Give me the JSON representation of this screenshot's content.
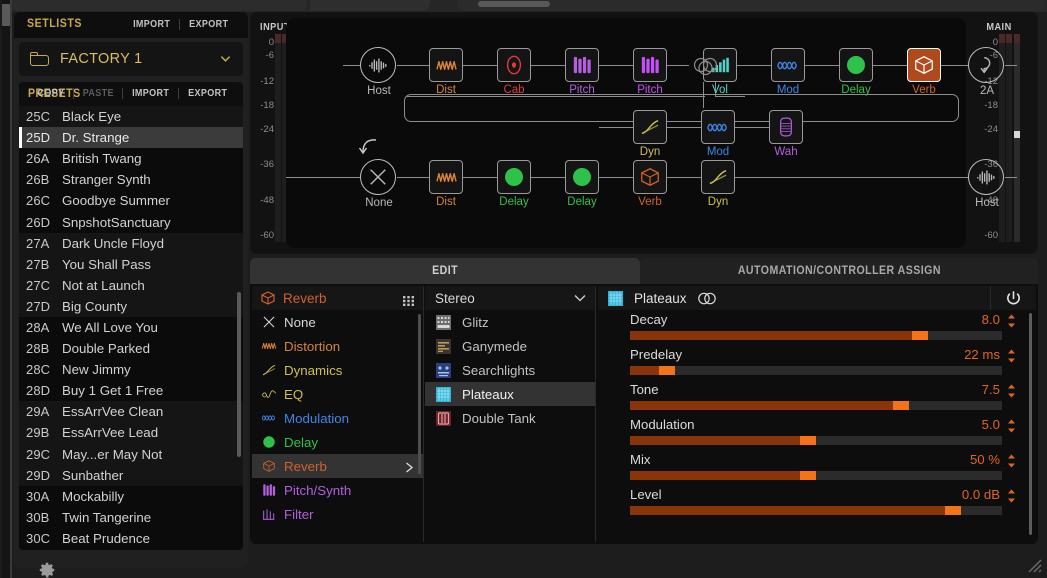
{
  "sidebar": {
    "setlists": {
      "title": "SETLISTS",
      "actions": [
        {
          "label": "IMPORT",
          "dim": false
        },
        {
          "label": "EXPORT",
          "dim": false
        }
      ],
      "selected": "FACTORY 1",
      "folder_icon": "folder-icon",
      "chevron_icon": "chevron-down-icon"
    },
    "presets": {
      "title": "PRESETS",
      "actions": [
        {
          "label": "COPY",
          "dim": false
        },
        {
          "label": "PASTE",
          "dim": true
        },
        {
          "label": "IMPORT",
          "dim": false
        },
        {
          "label": "EXPORT",
          "dim": false
        }
      ],
      "items": [
        {
          "num": "25C",
          "name": "Black Eye",
          "band": true,
          "selected": false
        },
        {
          "num": "25D",
          "name": "Dr. Strange",
          "band": true,
          "selected": true
        },
        {
          "num": "26A",
          "name": "British Twang",
          "band": false,
          "selected": false
        },
        {
          "num": "26B",
          "name": "Stranger Synth",
          "band": false,
          "selected": false
        },
        {
          "num": "26C",
          "name": "Goodbye Summer",
          "band": false,
          "selected": false
        },
        {
          "num": "26D",
          "name": "SnpshotSanctuary",
          "band": false,
          "selected": false
        },
        {
          "num": "27A",
          "name": "Dark Uncle Floyd",
          "band": true,
          "selected": false
        },
        {
          "num": "27B",
          "name": "You Shall Pass",
          "band": true,
          "selected": false
        },
        {
          "num": "27C",
          "name": "Not at Launch",
          "band": true,
          "selected": false
        },
        {
          "num": "27D",
          "name": "Big County",
          "band": true,
          "selected": false
        },
        {
          "num": "28A",
          "name": "We All Love You",
          "band": false,
          "selected": false
        },
        {
          "num": "28B",
          "name": "Double Parked",
          "band": false,
          "selected": false
        },
        {
          "num": "28C",
          "name": "New Jimmy",
          "band": false,
          "selected": false
        },
        {
          "num": "28D",
          "name": "Buy 1 Get 1 Free",
          "band": false,
          "selected": false
        },
        {
          "num": "29A",
          "name": "EssArrVee Clean",
          "band": true,
          "selected": false
        },
        {
          "num": "29B",
          "name": "EssArrVee Lead",
          "band": true,
          "selected": false
        },
        {
          "num": "29C",
          "name": "May...er May Not",
          "band": true,
          "selected": false
        },
        {
          "num": "29D",
          "name": "Sunbather",
          "band": true,
          "selected": false
        },
        {
          "num": "30A",
          "name": "Mockabilly",
          "band": false,
          "selected": false
        },
        {
          "num": "30B",
          "name": "Twin Tangerine",
          "band": false,
          "selected": false
        },
        {
          "num": "30C",
          "name": "Beat Prudence",
          "band": false,
          "selected": false
        }
      ]
    },
    "gear_icon": "gear-icon"
  },
  "routing": {
    "input_meter": {
      "label": "INPUT",
      "ticks": [
        "0",
        "-6",
        "-12",
        "-18",
        "-24",
        "-36",
        "-48",
        "-60"
      ],
      "peak_db": "-20"
    },
    "main_meter": {
      "label": "MAIN",
      "ticks": [
        "0",
        "-6",
        "-12",
        "-18",
        "-24",
        "-36",
        "-48",
        "-60"
      ],
      "peak_db": "-21"
    },
    "row1": [
      {
        "label": "Host",
        "icon": "waveform-icon",
        "color": "#b9b9b9",
        "type": "node"
      },
      {
        "label": "Dist",
        "icon": "distortion-icon",
        "color": "#d98432",
        "type": "block"
      },
      {
        "label": "Cab",
        "icon": "cabinet-icon",
        "color": "#e03a3a",
        "type": "block"
      },
      {
        "label": "Pitch",
        "icon": "pitch-icon",
        "color": "#b35fe0",
        "type": "block"
      },
      {
        "label": "Pitch",
        "icon": "pitch-icon",
        "color": "#c451f5",
        "type": "block"
      },
      {
        "label": "Vol",
        "icon": "volume-icon",
        "color": "#4fd6c8",
        "type": "block"
      },
      {
        "label": "Mod",
        "icon": "modulation-icon",
        "color": "#3d86e8",
        "type": "block"
      },
      {
        "label": "Delay",
        "icon": "delay-icon",
        "color": "#2fc24a",
        "type": "block"
      },
      {
        "label": "Verb",
        "icon": "reverb-icon",
        "color": "#d2622a",
        "type": "block",
        "selected": true
      },
      {
        "label": "2A",
        "icon": "output-arrow-icon",
        "color": "#b9b9b9",
        "type": "node"
      }
    ],
    "row2": [
      {
        "label": "Dyn",
        "icon": "dynamics-icon",
        "color": "#cfc04a",
        "type": "block"
      },
      {
        "label": "Mod",
        "icon": "modulation-icon",
        "color": "#3d86e8",
        "type": "block"
      },
      {
        "label": "Wah",
        "icon": "wah-icon",
        "color": "#b35fe0",
        "type": "block"
      }
    ],
    "row3": [
      {
        "label": "None",
        "icon": "none-x-icon",
        "color": "#b9b9b9",
        "type": "node"
      },
      {
        "label": "Dist",
        "icon": "distortion-icon",
        "color": "#d98432",
        "type": "block"
      },
      {
        "label": "Delay",
        "icon": "delay-icon",
        "color": "#2fc24a",
        "type": "block"
      },
      {
        "label": "Delay",
        "icon": "delay-icon",
        "color": "#2fc24a",
        "type": "block"
      },
      {
        "label": "Verb",
        "icon": "reverb-icon",
        "color": "#d2622a",
        "type": "block"
      },
      {
        "label": "Dyn",
        "icon": "dynamics-icon",
        "color": "#cfc04a",
        "type": "block"
      },
      {
        "label": "Host",
        "icon": "waveform-icon",
        "color": "#b9b9b9",
        "type": "node"
      }
    ]
  },
  "editor": {
    "tabs": [
      {
        "label": "EDIT",
        "active": true
      },
      {
        "label": "AUTOMATION/CONTROLLER ASSIGN",
        "active": false
      }
    ],
    "category_header": {
      "label": "Reverb",
      "icon": "reverb-icon",
      "grid_icon": "grid-icon"
    },
    "categories": [
      {
        "label": "None",
        "icon": "none-x-icon",
        "color": "#d8d8d8",
        "selected": false
      },
      {
        "label": "Distortion",
        "icon": "distortion-icon",
        "color": "#d98432",
        "selected": false
      },
      {
        "label": "Dynamics",
        "icon": "dynamics-icon",
        "color": "#cfc04a",
        "selected": false
      },
      {
        "label": "EQ",
        "icon": "eq-icon",
        "color": "#cfc04a",
        "selected": false
      },
      {
        "label": "Modulation",
        "icon": "modulation-icon",
        "color": "#3d86e8",
        "selected": false
      },
      {
        "label": "Delay",
        "icon": "delay-icon",
        "color": "#2fc24a",
        "selected": false
      },
      {
        "label": "Reverb",
        "icon": "reverb-icon",
        "color": "#d2622a",
        "selected": true
      },
      {
        "label": "Pitch/Synth",
        "icon": "pitch-icon",
        "color": "#b35fe0",
        "selected": false
      },
      {
        "label": "Filter",
        "icon": "filter-icon",
        "color": "#b35fe0",
        "selected": false
      }
    ],
    "model_header": {
      "label": "Stereo",
      "chevron_icon": "chevron-down-icon"
    },
    "models": [
      {
        "label": "Glitz",
        "icon": "glitz-thumb-icon",
        "selected": false
      },
      {
        "label": "Ganymede",
        "icon": "ganymede-thumb-icon",
        "selected": false
      },
      {
        "label": "Searchlights",
        "icon": "searchlights-thumb-icon",
        "selected": false
      },
      {
        "label": "Plateaux",
        "icon": "plateaux-thumb-icon",
        "selected": true
      },
      {
        "label": "Double Tank",
        "icon": "double-tank-thumb-icon",
        "selected": false
      }
    ],
    "param_header": {
      "title": "Plateaux",
      "icon": "plateaux-thumb-icon",
      "stereo_icon": "stereo-link-icon",
      "power_icon": "power-icon"
    },
    "parameters": [
      {
        "name": "Decay",
        "value": "8.0",
        "percent": 80
      },
      {
        "name": "Predelay",
        "value": "22 ms",
        "percent": 12
      },
      {
        "name": "Tone",
        "value": "7.5",
        "percent": 75
      },
      {
        "name": "Modulation",
        "value": "5.0",
        "percent": 50
      },
      {
        "name": "Mix",
        "value": "50 %",
        "percent": 50
      },
      {
        "name": "Level",
        "value": "0.0 dB",
        "percent": 89
      }
    ]
  },
  "window": {
    "resize_grip_icon": "resize-grip-icon"
  },
  "colors": {
    "accent_orange": "#f47317",
    "gold": "#c8a94a",
    "selection_gray": "#333333",
    "panel_bg": "#0d0d0d"
  }
}
